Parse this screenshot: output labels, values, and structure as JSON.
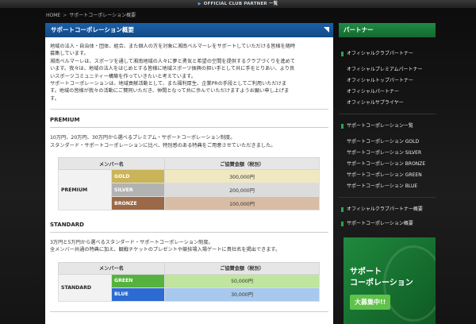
{
  "top_banner": {
    "label": "OFFICIAL CLUB PARTNER 一覧"
  },
  "breadcrumb": {
    "home": "HOME",
    "separator": ">",
    "current": "サポートコーポレーション概要"
  },
  "main": {
    "header_title": "サポートコーポレーション概要",
    "intro_lines": [
      "地域の法人・自治体・団体、組合、また個人の方を対象に湘南ベルマーレをサポートしていただける皆様を随時",
      "募集しています。",
      "湘南ベルマーレは、スポーツを通して湘南地域の人々に夢と勇気と希望の空間を提供するクラブづくりを進めて",
      "います。我々は、地域の法人をはじめとする皆様に地域スポーツ振興の担い手として共に手をとりあい、より良",
      "いスポーツコミュニティー構築を作っていきたいと考えています。",
      "サポートコーポレーションは、地域貢献活動として、また福利厚生、企業PRの手段としてご利用いただけま",
      "す。地域の皆様が我々の活動にご賛同いただき、仲間となって共に歩んでいただけますようお願い申し上げま",
      "す。"
    ],
    "premium": {
      "title": "PREMIUM",
      "desc_lines": [
        "10万円、20万円、30万円から選べるプレミアム・サポートコーポレーション制度。",
        "スタンダード・サポートコーポレーションに比べ、特別感のある特典をご用意させていただきました。"
      ],
      "col_member": "メンバー名",
      "col_amount": "ご協賛金額（税別）",
      "row_label": "PREMIUM",
      "tiers": [
        {
          "name": "GOLD",
          "amount": "300,000円",
          "color": "#c9b45a",
          "fill": "#efe8c1"
        },
        {
          "name": "SILVER",
          "amount": "200,000円",
          "color": "#b2b2b2",
          "fill": "#dcdcdc"
        },
        {
          "name": "BRONZE",
          "amount": "100,000円",
          "color": "#9a6a48",
          "fill": "#d9bca4"
        }
      ]
    },
    "standard": {
      "title": "STANDARD",
      "desc_lines": [
        "3万円と5万円から選べるスタンダード・サポートコーポレーション制度。",
        "全メンバー共通の特典に加え、観戦チケットのプレゼントや競技場入場ゲートに貴社名を掲出できます。"
      ],
      "col_member": "メンバー名",
      "col_amount": "ご協賛金額（税別）",
      "row_label": "STANDARD",
      "tiers": [
        {
          "name": "GREEN",
          "amount": "50,000円",
          "color": "#55b23c",
          "fill": "#bfe59e"
        },
        {
          "name": "BLUE",
          "amount": "30,000円",
          "color": "#2c6bd1",
          "fill": "#a7c9ee"
        }
      ]
    }
  },
  "sidebar": {
    "header": "パートナー",
    "groups": [
      {
        "title": "オフィシャルクラブパートナー",
        "items": [
          "オフィシャルプレミアムパートナー",
          "オフィシャルトップパートナー",
          "オフィシャルパートナー",
          "オフィシャルサプライヤー"
        ]
      },
      {
        "title": "サポートコーポレーション一覧",
        "items": [
          "サポートコーポレーション GOLD",
          "サポートコーポレーション SILVER",
          "サポートコーポレーション BRONZE",
          "サポートコーポレーション GREEN",
          "サポートコーポレーション BLUE"
        ]
      },
      {
        "title": "オフィシャルクラブパートナー概要",
        "items": []
      },
      {
        "title": "サポートコーポレーション概要",
        "items": []
      }
    ],
    "banner": {
      "line1": "サポート",
      "line2": "コーポレーション",
      "cta": "大募集中!!"
    }
  },
  "colors": {
    "main_header": "#1b5fa8",
    "sidebar_header": "#1e8a45"
  }
}
